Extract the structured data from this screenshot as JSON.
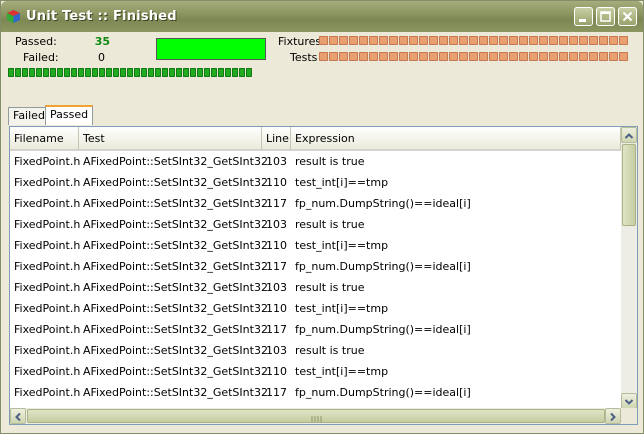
{
  "window": {
    "title": "Unit Test :: Finished",
    "accent": "#8c9660"
  },
  "summary": {
    "passed_label": "Passed:",
    "passed_value": "35",
    "failed_label": "Failed:",
    "failed_value": "0",
    "result_color": "#00ff00",
    "fixtures_label": "Fixtures",
    "tests_label": "Tests",
    "progress_color": "#e8a070",
    "overall_progress_color": "#22aa22"
  },
  "tabs": [
    {
      "label": "Failed"
    },
    {
      "label": "Passed"
    }
  ],
  "table": {
    "columns": [
      "Filename",
      "Test",
      "Line",
      "Expression"
    ],
    "rows": [
      [
        "FixedPoint.h",
        "AFixedPoint::SetSInt32_GetSInt32",
        "103",
        "result is true"
      ],
      [
        "FixedPoint.h",
        "AFixedPoint::SetSInt32_GetSInt32",
        "110",
        "test_int[i]==tmp"
      ],
      [
        "FixedPoint.h",
        "AFixedPoint::SetSInt32_GetSInt32",
        "117",
        "fp_num.DumpString()==ideal[i]"
      ],
      [
        "FixedPoint.h",
        "AFixedPoint::SetSInt32_GetSInt32",
        "103",
        "result is true"
      ],
      [
        "FixedPoint.h",
        "AFixedPoint::SetSInt32_GetSInt32",
        "110",
        "test_int[i]==tmp"
      ],
      [
        "FixedPoint.h",
        "AFixedPoint::SetSInt32_GetSInt32",
        "117",
        "fp_num.DumpString()==ideal[i]"
      ],
      [
        "FixedPoint.h",
        "AFixedPoint::SetSInt32_GetSInt32",
        "103",
        "result is true"
      ],
      [
        "FixedPoint.h",
        "AFixedPoint::SetSInt32_GetSInt32",
        "110",
        "test_int[i]==tmp"
      ],
      [
        "FixedPoint.h",
        "AFixedPoint::SetSInt32_GetSInt32",
        "117",
        "fp_num.DumpString()==ideal[i]"
      ],
      [
        "FixedPoint.h",
        "AFixedPoint::SetSInt32_GetSInt32",
        "103",
        "result is true"
      ],
      [
        "FixedPoint.h",
        "AFixedPoint::SetSInt32_GetSInt32",
        "110",
        "test_int[i]==tmp"
      ],
      [
        "FixedPoint.h",
        "AFixedPoint::SetSInt32_GetSInt32",
        "117",
        "fp_num.DumpString()==ideal[i]"
      ]
    ]
  },
  "icons": {
    "app": "cube-icon",
    "minimize": "minimize-icon",
    "maximize": "maximize-icon",
    "close": "close-icon"
  }
}
